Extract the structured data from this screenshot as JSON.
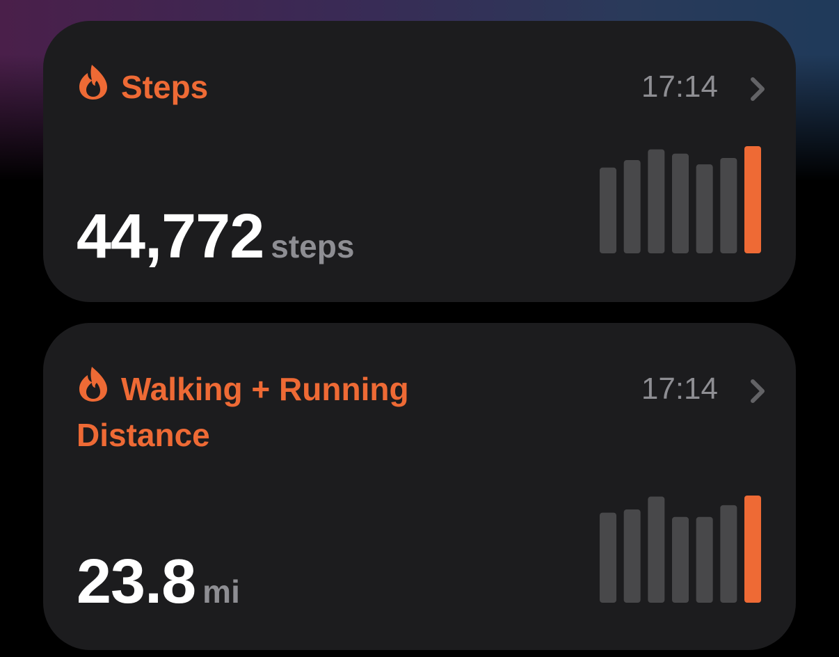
{
  "cards": [
    {
      "id": "steps",
      "title": "Steps",
      "time": "17:14",
      "value": "44,772",
      "unit": "steps",
      "icon": "flame-icon",
      "bars": [
        0.8,
        0.87,
        0.97,
        0.93,
        0.83,
        0.89,
        1.0
      ]
    },
    {
      "id": "distance",
      "title": "Walking + Running Distance",
      "time": "17:14",
      "value": "23.8",
      "unit": "mi",
      "icon": "flame-icon",
      "bars": [
        0.84,
        0.87,
        0.99,
        0.8,
        0.8,
        0.91,
        1.0
      ]
    }
  ],
  "colors": {
    "accent": "#ee6a35",
    "bar_inactive": "#48484a",
    "bar_active": "#ee6a35",
    "card_bg": "#1c1c1e",
    "secondary_text": "#8e8e93"
  }
}
